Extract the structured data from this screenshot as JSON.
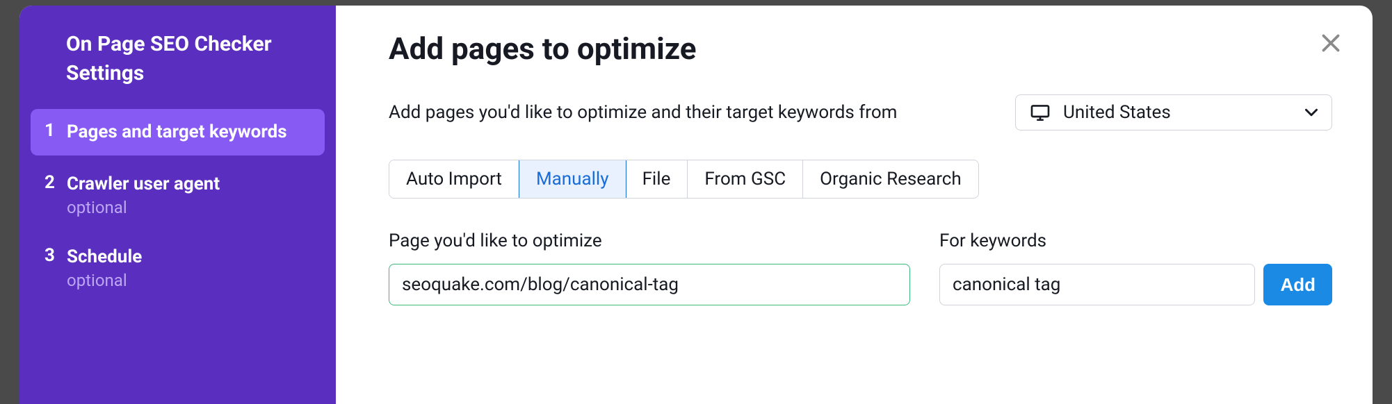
{
  "sidebar": {
    "title": "On Page SEO Checker Settings",
    "steps": [
      {
        "number": "1",
        "label": "Pages and target keywords",
        "optional": null,
        "active": true
      },
      {
        "number": "2",
        "label": "Crawler user agent",
        "optional": "optional",
        "active": false
      },
      {
        "number": "3",
        "label": "Schedule",
        "optional": "optional",
        "active": false
      }
    ]
  },
  "main": {
    "title": "Add pages to optimize",
    "description": "Add pages you'd like to optimize and their target keywords from",
    "country": "United States",
    "tabs": [
      {
        "label": "Auto Import",
        "active": false
      },
      {
        "label": "Manually",
        "active": true
      },
      {
        "label": "File",
        "active": false
      },
      {
        "label": "From GSC",
        "active": false
      },
      {
        "label": "Organic Research",
        "active": false
      }
    ],
    "form": {
      "page_label": "Page you'd like to optimize",
      "page_value": "seoquake.com/blog/canonical-tag",
      "keywords_label": "For keywords",
      "keywords_value": "canonical tag",
      "add_button": "Add"
    }
  }
}
